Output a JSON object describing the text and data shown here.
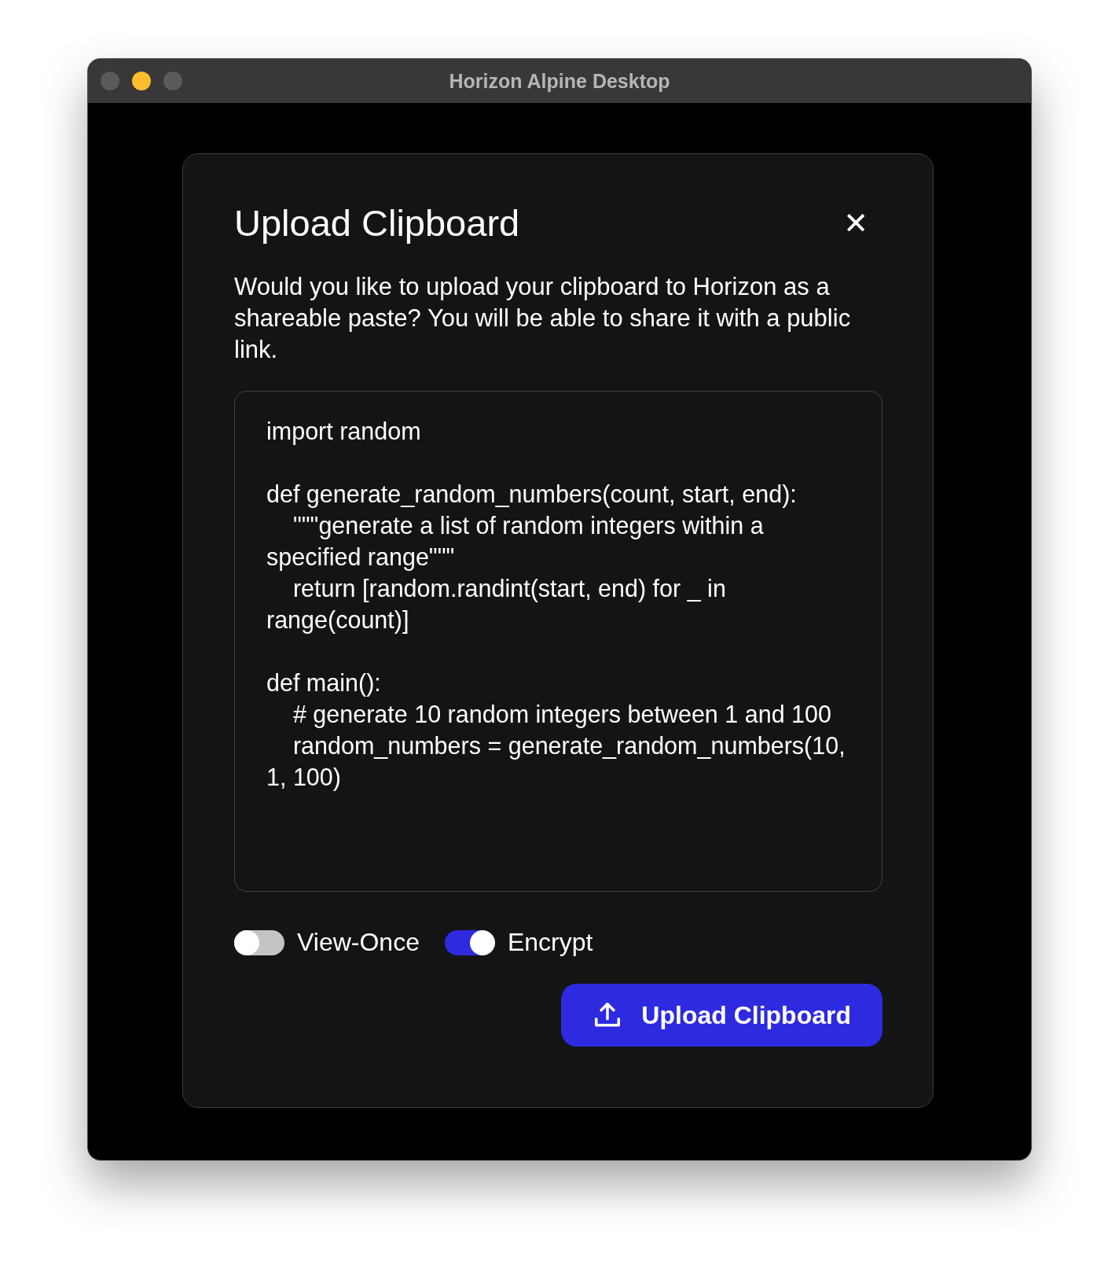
{
  "window": {
    "title": "Horizon Alpine Desktop",
    "traffic_lights": [
      {
        "color": "#5a5a5a"
      },
      {
        "color": "#febc2e"
      },
      {
        "color": "#5a5a5a"
      }
    ]
  },
  "dialog": {
    "title": "Upload Clipboard",
    "close": "✕",
    "message": "Would you like to upload your clipboard to Horizon as a shareable paste? You will be able to share it with a public link.",
    "clipboard": "import random\n\ndef generate_random_numbers(count, start, end):\n    \"\"\"generate a list of random integers within a specified range\"\"\"\n    return [random.randint(start, end) for _ in range(count)]\n\ndef main():\n    # generate 10 random integers between 1 and 100\n    random_numbers = generate_random_numbers(10, 1, 100)",
    "toggles": [
      {
        "label": "View-Once",
        "on": false
      },
      {
        "label": "Encrypt",
        "on": true
      }
    ],
    "button": "Upload Clipboard"
  }
}
